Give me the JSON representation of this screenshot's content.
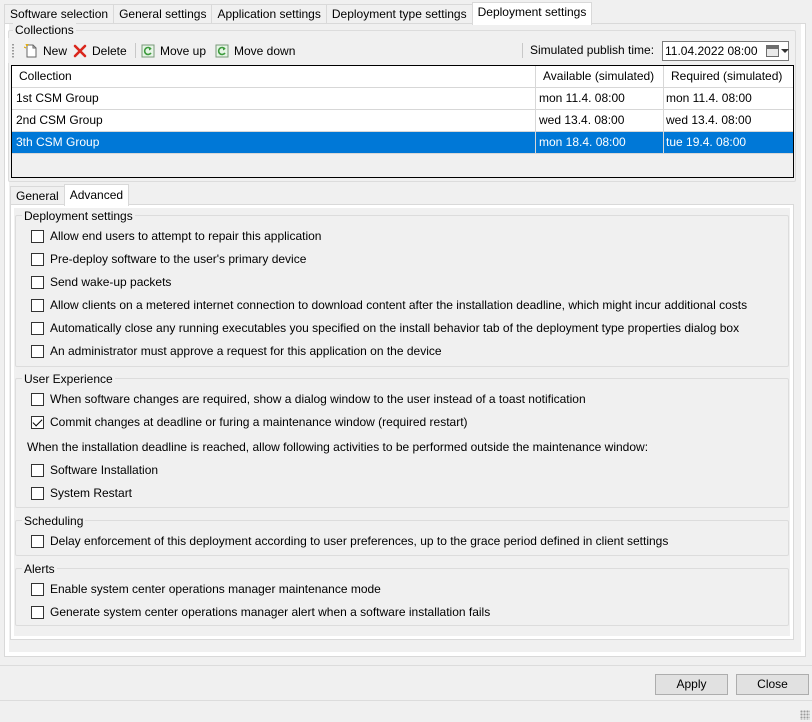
{
  "top_tabs": [
    {
      "label": "Software selection"
    },
    {
      "label": "General settings"
    },
    {
      "label": "Application settings"
    },
    {
      "label": "Deployment type settings"
    },
    {
      "label": "Deployment settings"
    }
  ],
  "collections": {
    "title": "Collections",
    "toolbar": {
      "new_label": "New",
      "delete_label": "Delete",
      "move_up_label": "Move up",
      "move_down_label": "Move down",
      "publish_time_label": "Simulated publish time:",
      "publish_time_value": "11.04.2022 08:00"
    },
    "columns": [
      "Collection",
      "Available (simulated)",
      "Required (simulated)"
    ],
    "rows": [
      {
        "collection": "1st CSM Group",
        "available": "mon 11.4. 08:00",
        "required": "mon 11.4. 08:00",
        "selected": false
      },
      {
        "collection": "2nd CSM Group",
        "available": "wed 13.4. 08:00",
        "required": "wed 13.4. 08:00",
        "selected": false
      },
      {
        "collection": "3th CSM Group",
        "available": "mon 18.4. 08:00",
        "required": "tue 19.4. 08:00",
        "selected": true
      }
    ]
  },
  "inner_tabs": [
    {
      "label": "General"
    },
    {
      "label": "Advanced"
    }
  ],
  "deployment_settings": {
    "title": "Deployment settings",
    "options": [
      {
        "label": "Allow end users to attempt to repair this application",
        "checked": false
      },
      {
        "label": "Pre-deploy software to the user's primary device",
        "checked": false
      },
      {
        "label": "Send wake-up packets",
        "checked": false
      },
      {
        "label": "Allow clients on a metered internet connection to download content after the installation deadline, which might incur additional costs",
        "checked": false
      },
      {
        "label": "Automatically close any running executables you specified on the install behavior tab of the deployment type properties dialog box",
        "checked": false
      },
      {
        "label": "An administrator must approve a request for this application on the device",
        "checked": false
      }
    ]
  },
  "user_experience": {
    "title": "User Experience",
    "options": [
      {
        "label": "When software changes are required, show a dialog window to the user instead of a toast notification",
        "checked": false
      },
      {
        "label": "Commit changes at deadline or furing a maintenance window (required restart)",
        "checked": true
      }
    ],
    "note": "When the installation deadline is reached, allow following activities to be performed outside the maintenance window:",
    "activities": [
      {
        "label": "Software Installation",
        "checked": false
      },
      {
        "label": "System Restart",
        "checked": false
      }
    ]
  },
  "scheduling": {
    "title": "Scheduling",
    "options": [
      {
        "label": "Delay enforcement of this deployment according to user preferences, up to the grace period defined in client settings",
        "checked": false
      }
    ]
  },
  "alerts": {
    "title": "Alerts",
    "options": [
      {
        "label": "Enable system center operations manager maintenance mode",
        "checked": false
      },
      {
        "label": "Generate system center operations manager alert when a software installation fails",
        "checked": false
      }
    ]
  },
  "buttons": {
    "apply_label": "Apply",
    "close_label": "Close"
  },
  "icons": {
    "new": "new-document-icon",
    "delete": "red-x-icon",
    "move_up": "green-refresh-icon",
    "move_down": "green-refresh-icon",
    "calendar": "calendar-icon"
  },
  "colors": {
    "selection": "#0078d7",
    "delete_icon": "#d9261c",
    "move_icon": "#4caf50"
  }
}
